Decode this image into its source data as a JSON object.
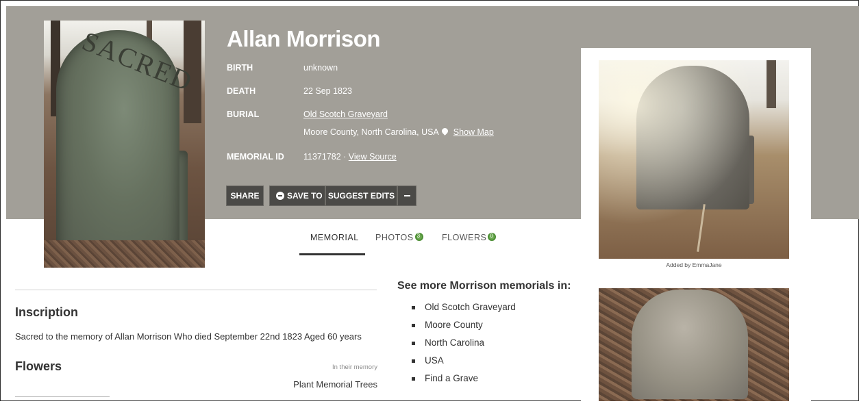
{
  "person": {
    "name": "Allan Morrison",
    "birth_label": "BIRTH",
    "birth_value": "unknown",
    "death_label": "DEATH",
    "death_value": "22 Sep 1823",
    "burial_label": "BURIAL",
    "burial_cemetery": "Old Scotch Graveyard",
    "burial_location": "Moore County, North Carolina, USA",
    "show_map": "Show Map",
    "memorial_id_label": "MEMORIAL ID",
    "memorial_id": "11371782",
    "view_source": "View Source"
  },
  "actions": {
    "share": "SHARE",
    "save_to": "SAVE TO",
    "suggest_edits": "SUGGEST EDITS"
  },
  "tabs": {
    "memorial": "MEMORIAL",
    "photos": "PHOTOS",
    "photos_count": "3",
    "flowers": "FLOWERS",
    "flowers_count": "0"
  },
  "inscription": {
    "heading": "Inscription",
    "text": "Sacred to the memory of Allan Morrison Who died September 22nd 1823 Aged 60 years"
  },
  "flowers": {
    "heading": "Flowers",
    "in_memory": "In their memory",
    "plant_trees": "Plant Memorial Trees"
  },
  "see_more": {
    "prefix": "See more ",
    "surname": "Morrison",
    "suffix": " memorials in:",
    "items": [
      "Old Scotch Graveyard",
      "Moore County",
      "North Carolina",
      "USA",
      "Find a Grave"
    ]
  },
  "photo_caption": "Added by EmmaJane",
  "main_photo_engraving": "SACRED",
  "colors": {
    "header_bg": "#a29f98",
    "button_bg": "#4b4a47",
    "badge_green": "#6aa84f"
  },
  "icons": [
    "map-pin-icon",
    "minus-circle-icon",
    "dash-icon"
  ]
}
